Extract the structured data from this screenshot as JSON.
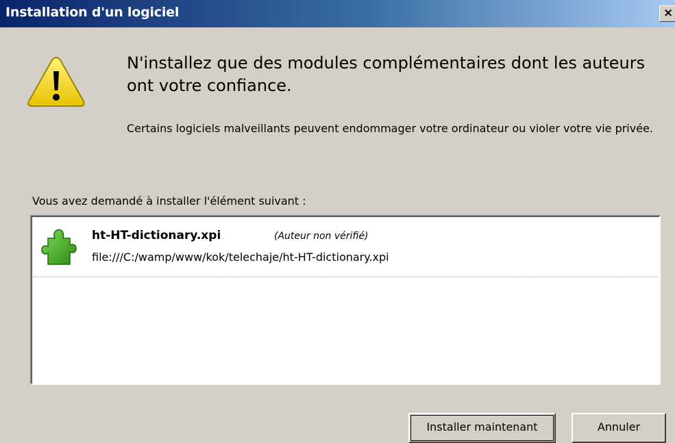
{
  "window": {
    "title": "Installation d'un logiciel",
    "close_glyph": "×"
  },
  "warning": {
    "icon": "warning-triangle-icon",
    "headline": "N'installez que des modules complémentaires dont les auteurs ont votre confiance.",
    "description": "Certains logiciels malveillants peuvent endommager votre ordinateur ou violer votre vie privée."
  },
  "request_label": "Vous avez demandé à installer l'élément suivant :",
  "items": [
    {
      "icon": "puzzle-piece-icon",
      "name": "ht-HT-dictionary.xpi",
      "author": "(Auteur non vérifié)",
      "url": "file:///C:/wamp/www/kok/telechaje/ht-HT-dictionary.xpi"
    }
  ],
  "buttons": {
    "install": "Installer maintenant",
    "cancel": "Annuler"
  },
  "colors": {
    "titlebar_start": "#0a246a",
    "titlebar_end": "#a6caf0",
    "dialog_bg": "#d4d0c8",
    "warning_yellow": "#f5d90a",
    "puzzle_green": "#4caf27"
  }
}
